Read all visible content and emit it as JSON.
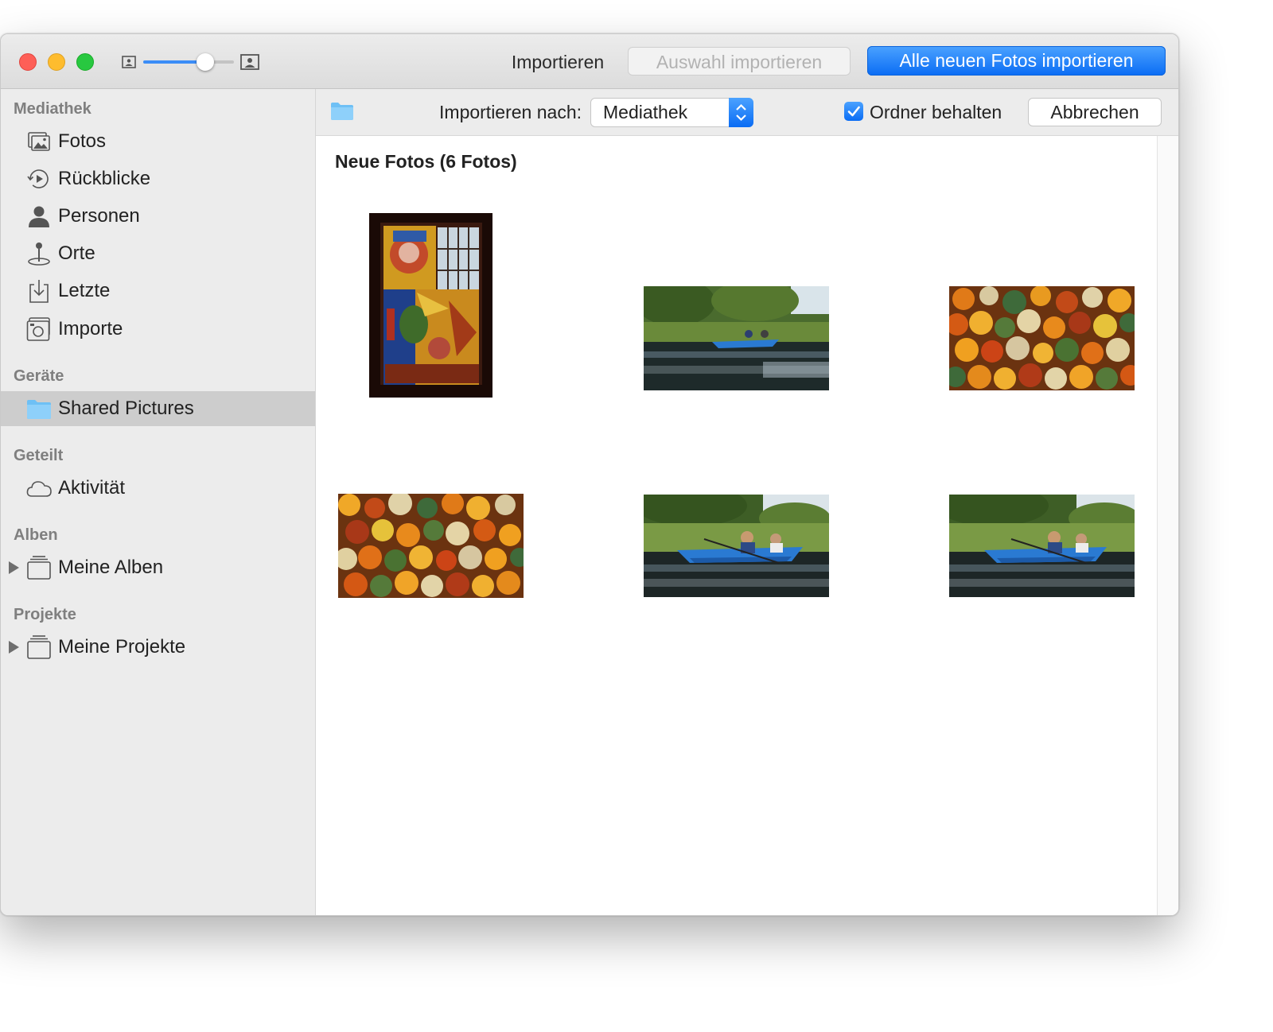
{
  "titlebar": {
    "import_label": "Importieren",
    "import_selection": "Auswahl importieren",
    "import_all": "Alle neuen Fotos importieren",
    "zoom_level": 0.68
  },
  "sidebar": {
    "sections": [
      {
        "title": "Mediathek",
        "items": [
          "Fotos",
          "Rückblicke",
          "Personen",
          "Orte",
          "Letzte",
          "Importe"
        ]
      },
      {
        "title": "Geräte",
        "items": [
          "Shared Pictures"
        ]
      },
      {
        "title": "Geteilt",
        "items": [
          "Aktivität"
        ]
      },
      {
        "title": "Alben",
        "items": [
          "Meine Alben"
        ]
      },
      {
        "title": "Projekte",
        "items": [
          "Meine Projekte"
        ]
      }
    ],
    "selected_item": "Shared Pictures"
  },
  "importbar": {
    "destination_label": "Importieren nach:",
    "destination_value": "Mediathek",
    "keep_folders_label": "Ordner behalten",
    "keep_folders_checked": true,
    "cancel": "Abbrechen"
  },
  "main": {
    "new_photos_title": "Neue Fotos (6 Fotos)"
  },
  "colors": {
    "accent": "#0a6cf4",
    "sidebar_bg": "#ececec",
    "selection": "#cdcdcd"
  }
}
